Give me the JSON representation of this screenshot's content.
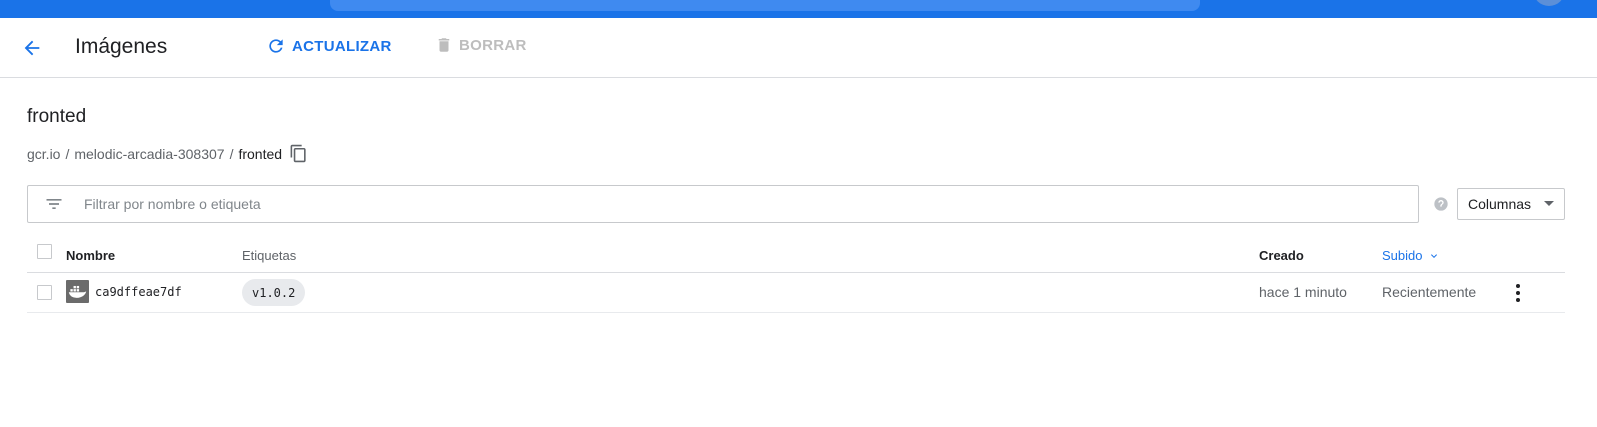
{
  "header": {
    "title": "Imágenes",
    "back_icon": "arrow-back-icon",
    "refresh_label": "ACTUALIZAR",
    "delete_label": "BORRAR"
  },
  "colors": {
    "accent": "#1a73e8",
    "disabled": "#bdbdbd"
  },
  "image": {
    "name": "fronted",
    "breadcrumb": [
      "gcr.io",
      "melodic-arcadia-308307",
      "fronted"
    ]
  },
  "filter": {
    "placeholder": "Filtrar por nombre o etiqueta",
    "columns_label": "Columnas"
  },
  "table": {
    "columns": {
      "name": "Nombre",
      "tags": "Etiquetas",
      "created": "Creado",
      "uploaded": "Subido"
    },
    "sorted_by": "Subido",
    "rows": [
      {
        "digest": "ca9dffeae7df",
        "tag": "v1.0.2",
        "created": "hace 1 minuto",
        "uploaded": "Recientemente"
      }
    ]
  }
}
